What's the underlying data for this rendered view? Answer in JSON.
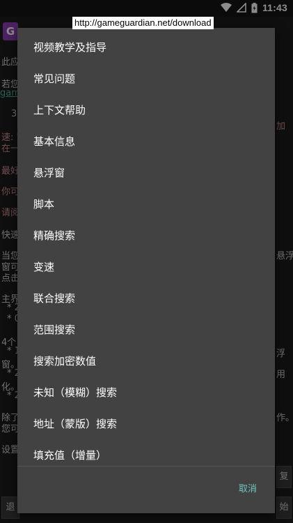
{
  "status_bar": {
    "time": "11:43",
    "icons": [
      "wifi-icon",
      "signal-icon",
      "battery-charging-icon"
    ]
  },
  "url_label": "http://gameguardian.net/download",
  "background": {
    "logo": "G",
    "fragments": [
      "此应",
      "若您",
      "gam",
      "3:",
      "速: '",
      "在一",
      "最好",
      "你可",
      "请阅",
      "快速",
      "当您",
      "窗可",
      "点击",
      "主界",
      "* 2",
      "* 0",
      "4个",
      "* 1",
      "窗。",
      "* 2",
      "化。",
      "* 2",
      "除了",
      "您可",
      "设置",
      "加",
      "悬浮",
      "浮",
      "用",
      "作。"
    ],
    "buttons": [
      "复",
      "退",
      "始"
    ]
  },
  "menu": {
    "items": [
      "视频教学及指导",
      "常见问题",
      "上下文帮助",
      "基本信息",
      "悬浮窗",
      "脚本",
      "精确搜索",
      "变速",
      "联合搜索",
      "范围搜索",
      "搜索加密数值",
      "未知（模糊）搜索",
      "地址（蒙版）搜索",
      "填充值（增量）"
    ],
    "cancel_label": "取消"
  },
  "colors": {
    "dialog_bg": "#424242",
    "accent": "#6fc4c0",
    "app_logo": "#8b3fb3"
  }
}
